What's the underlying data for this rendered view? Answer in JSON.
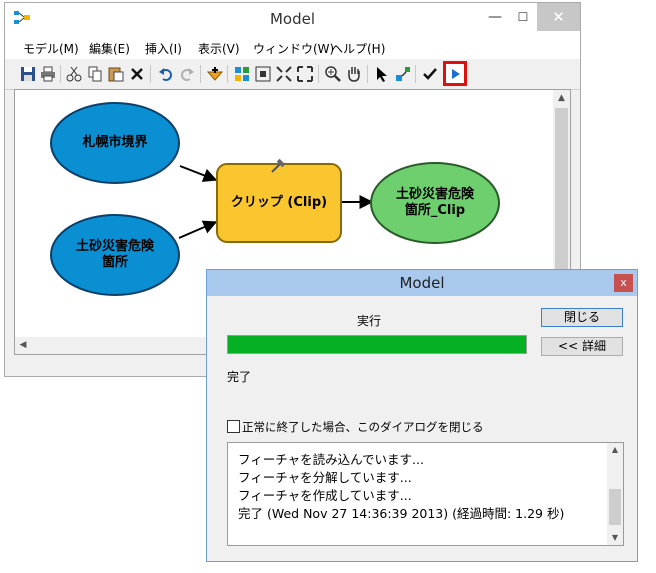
{
  "window": {
    "title": "Model",
    "minimize_glyph": "—",
    "maximize_glyph": "☐",
    "close_glyph": "✕"
  },
  "menu": {
    "items": [
      {
        "label": "モデル(M)"
      },
      {
        "label": "編集(E)"
      },
      {
        "label": "挿入(I)"
      },
      {
        "label": "表示(V)"
      },
      {
        "label": "ウィンドウ(W)"
      },
      {
        "label": "ヘルプ(H)"
      }
    ]
  },
  "toolbar": {
    "icons": [
      "save-icon",
      "print-icon",
      "cut-icon",
      "copy-icon",
      "paste-icon",
      "delete-icon",
      "undo-icon",
      "redo-icon",
      "add-data-icon",
      "auto-layout-icon",
      "fit-icon",
      "full-extent-icon",
      "fixed-zoom-icon",
      "zoom-in-icon",
      "pan-icon",
      "select-icon",
      "connect-icon",
      "validate-icon",
      "run-icon"
    ],
    "run_highlight_color": "#e01010"
  },
  "model": {
    "nodes": {
      "input1": {
        "label": "札幌市境界",
        "color": "#0a8fd2"
      },
      "input2": {
        "label_line1": "土砂災害危険",
        "label_line2": "箇所",
        "color": "#0a8fd2"
      },
      "tool": {
        "label": "クリップ (Clip)",
        "color": "#f9c630"
      },
      "output": {
        "label_line1": "土砂災害危険",
        "label_line2": "箇所_Clip",
        "color": "#6ecf6e"
      }
    }
  },
  "dialog": {
    "title": "Model",
    "close_glyph": "x",
    "status_label": "実行",
    "progress_percent": 100,
    "progress_color": "#06b025",
    "close_button": "閉じる",
    "details_button": "<< 詳細",
    "done_text": "完了",
    "checkbox_label": "正常に終了した場合、このダイアログを閉じる",
    "checkbox_checked": false,
    "log_lines": [
      "フィーチャを読み込んでいます...",
      "フィーチャを分解しています...",
      "フィーチャを作成しています...",
      "完了 (Wed Nov 27 14:36:39 2013) (経過時間: 1.29 秒)"
    ]
  }
}
